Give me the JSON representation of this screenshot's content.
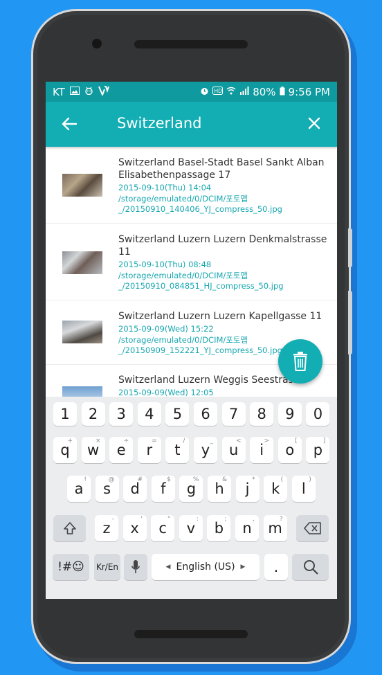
{
  "status_bar": {
    "carrier": "KT",
    "left_icons": [
      "image-icon",
      "android-debug-icon",
      "v-app-icon"
    ],
    "right_icons": [
      "alarm-icon",
      "hd-icon",
      "wifi-icon",
      "signal-icon"
    ],
    "battery": "80%",
    "time": "9:56 PM"
  },
  "toolbar": {
    "title": "Switzerland"
  },
  "items": [
    {
      "place": "Switzerland Basel-Stadt Basel Sankt Alban Elisabethenpassage 17",
      "date": "2015-09-10(Thu) 14:04",
      "path": "/storage/emulated/0/DCIM/포토맵_/20150910_140406_YJ_compress_50.jpg"
    },
    {
      "place": "Switzerland Luzern Luzern Denkmalstrasse 11",
      "date": "2015-09-10(Thu) 08:48",
      "path": "/storage/emulated/0/DCIM/포토맵_/20150910_084851_HJ_compress_50.jpg"
    },
    {
      "place": "Switzerland Luzern Luzern Kapellgasse 11",
      "date": "2015-09-09(Wed) 15:22",
      "path": "/storage/emulated/0/DCIM/포토맵_/20150909_152221_YJ_compress_50.jpg"
    },
    {
      "place": "Switzerland Luzern Weggis Seestrasse",
      "date": "2015-09-09(Wed) 12:05",
      "path": ""
    }
  ],
  "keyboard": {
    "numbers": [
      "1",
      "2",
      "3",
      "4",
      "5",
      "6",
      "7",
      "8",
      "9",
      "0"
    ],
    "row1": [
      {
        "k": "q",
        "h": "+"
      },
      {
        "k": "w",
        "h": "×"
      },
      {
        "k": "e",
        "h": "÷"
      },
      {
        "k": "r",
        "h": "="
      },
      {
        "k": "t",
        "h": "/"
      },
      {
        "k": "y",
        "h": "_"
      },
      {
        "k": "u",
        "h": "<"
      },
      {
        "k": "i",
        "h": ">"
      },
      {
        "k": "o",
        "h": "["
      },
      {
        "k": "p",
        "h": "]"
      }
    ],
    "row2": [
      {
        "k": "a",
        "h": "!"
      },
      {
        "k": "s",
        "h": "@"
      },
      {
        "k": "d",
        "h": "#"
      },
      {
        "k": "f",
        "h": "$"
      },
      {
        "k": "g",
        "h": "%"
      },
      {
        "k": "h",
        "h": "&"
      },
      {
        "k": "j",
        "h": "*"
      },
      {
        "k": "k",
        "h": "("
      },
      {
        "k": "l",
        "h": ")"
      }
    ],
    "row3": [
      {
        "k": "z",
        "h": "-"
      },
      {
        "k": "x",
        "h": "'"
      },
      {
        "k": "c",
        "h": "\""
      },
      {
        "k": "v",
        "h": ":"
      },
      {
        "k": "b",
        "h": ";"
      },
      {
        "k": "n",
        "h": ","
      },
      {
        "k": "m",
        "h": "?"
      }
    ],
    "symbols_label": "!#☺",
    "lang_switch_label": "Kr/En",
    "space_label": "English (US)",
    "period_label": "."
  }
}
